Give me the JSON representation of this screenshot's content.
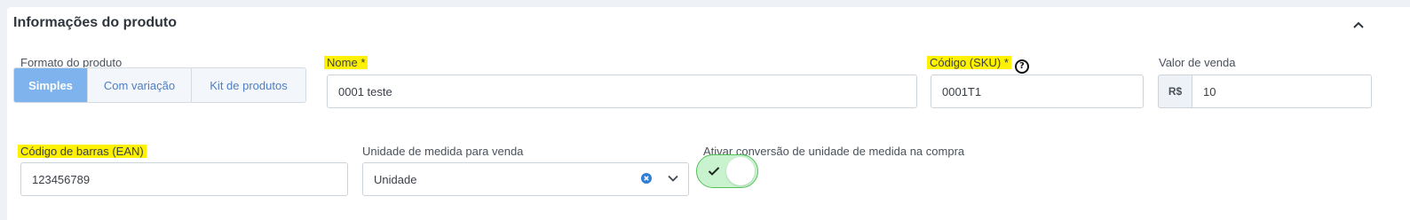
{
  "section": {
    "title": "Informações do produto"
  },
  "product_format": {
    "label": "Formato do produto",
    "options": [
      "Simples",
      "Com variação",
      "Kit de produtos"
    ],
    "selected": "Simples"
  },
  "name": {
    "label": "Nome",
    "required_mark": "*",
    "value": "0001 teste"
  },
  "sku": {
    "label": "Código (SKU)",
    "required_mark": "*",
    "help_glyph": "?",
    "value": "0001T1"
  },
  "price": {
    "label": "Valor de venda",
    "prefix": "R$",
    "value": "10"
  },
  "barcode": {
    "label": "Código de barras (EAN)",
    "value": "123456789"
  },
  "unit": {
    "label": "Unidade de medida para venda",
    "value": "Unidade"
  },
  "unit_conversion": {
    "label": "Ativar conversão de unidade de medida na compra",
    "enabled": true
  },
  "colors": {
    "highlight": "#fff200",
    "segment_active": "#7fb3ee",
    "toggle_on": "#c9f3cf",
    "toggle_border": "#53c25a",
    "clear_icon": "#2f7ed8"
  },
  "icons": [
    "chevron-up-icon",
    "help-icon",
    "clear-icon",
    "chevron-down-icon",
    "check-icon"
  ]
}
